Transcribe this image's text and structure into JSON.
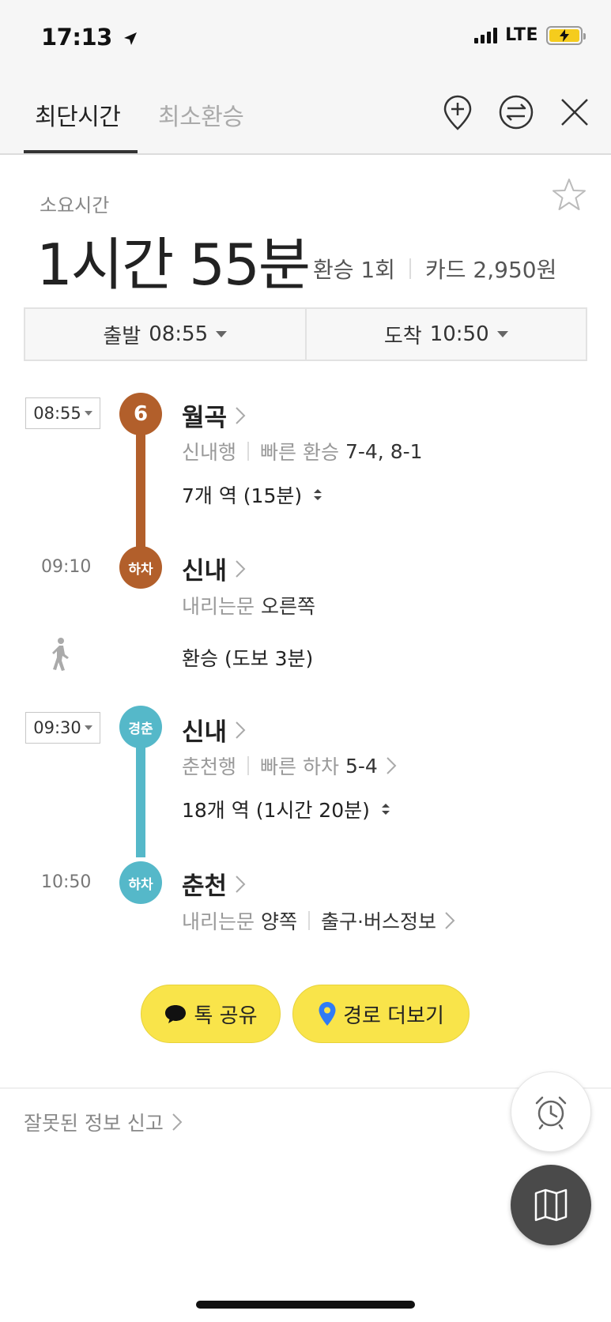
{
  "status": {
    "time": "17:13",
    "network": "LTE"
  },
  "tabs": [
    {
      "label": "최단시간",
      "active": true
    },
    {
      "label": "최소환승",
      "active": false
    }
  ],
  "summary": {
    "label": "소요시간",
    "total_time": "1시간 55분",
    "transfers": "환승 1회",
    "fare": "카드 2,950원"
  },
  "departure": {
    "label": "출발",
    "time": "08:55"
  },
  "arrival": {
    "label": "도착",
    "time": "10:50"
  },
  "route": {
    "seg1": {
      "time": "08:55",
      "badge": "6",
      "station": "월곡",
      "direction": "신내행",
      "fast_label": "빠른 환승",
      "fast_value": "7-4, 8-1",
      "count": "7개 역 (15분)"
    },
    "alight1": {
      "time": "09:10",
      "badge": "하차",
      "station": "신내",
      "door_label": "내리는문",
      "door_value": "오른쪽"
    },
    "walk": {
      "text": "환승 (도보 3분)"
    },
    "seg2": {
      "time": "09:30",
      "badge": "경춘",
      "station": "신내",
      "direction": "춘천행",
      "fast_label": "빠른 하차",
      "fast_value": "5-4",
      "count": "18개 역 (1시간 20분)"
    },
    "alight2": {
      "time": "10:50",
      "badge": "하차",
      "station": "춘천",
      "door_label": "내리는문",
      "door_value": "양쪽",
      "exit_info": "출구·버스정보"
    }
  },
  "buttons": {
    "share": "톡 공유",
    "more": "경로 더보기"
  },
  "report": "잘못된 정보 신고",
  "colors": {
    "line6": "#b25f2b",
    "gyeongchun": "#55b8c9",
    "accent_yellow": "#f9e44a"
  }
}
